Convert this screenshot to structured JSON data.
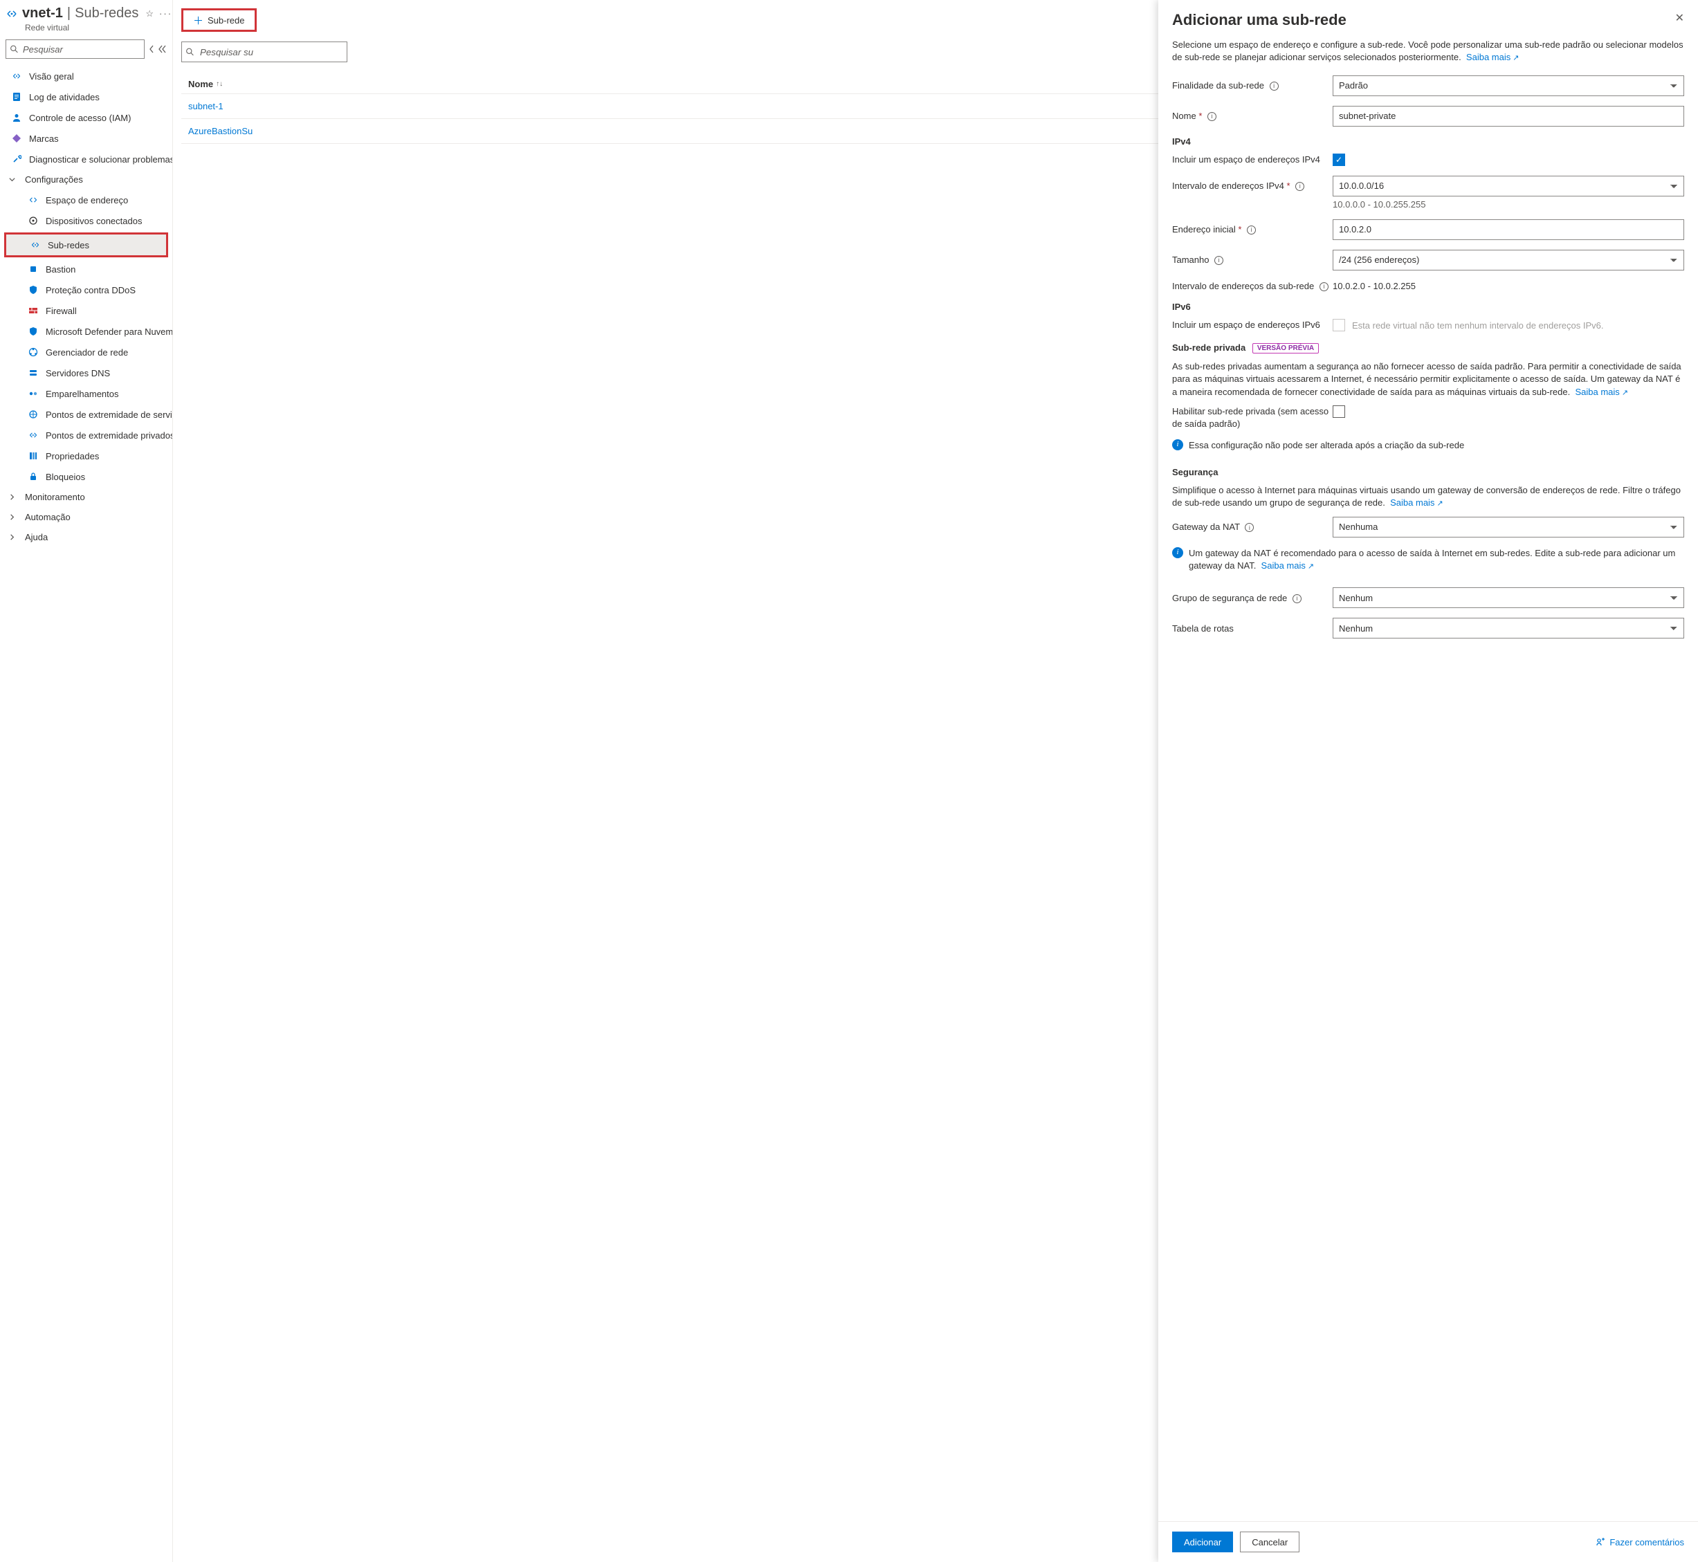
{
  "header": {
    "title": "vnet-1",
    "section": "Sub-redes",
    "subtype": "Rede virtual"
  },
  "sidebar": {
    "search_placeholder": "Pesquisar",
    "items": [
      {
        "label": "Visão geral"
      },
      {
        "label": "Log de atividades"
      },
      {
        "label": "Controle de acesso (IAM)"
      },
      {
        "label": "Marcas"
      },
      {
        "label": "Diagnosticar e solucionar problemas"
      }
    ],
    "config_group": "Configurações",
    "config_items": [
      {
        "label": "Espaço de endereço"
      },
      {
        "label": "Dispositivos conectados"
      },
      {
        "label": "Sub-redes"
      },
      {
        "label": "Bastion"
      },
      {
        "label": "Proteção contra DDoS"
      },
      {
        "label": "Firewall"
      },
      {
        "label": "Microsoft Defender para Nuvem"
      },
      {
        "label": "Gerenciador de rede"
      },
      {
        "label": "Servidores DNS"
      },
      {
        "label": "Emparelhamentos"
      },
      {
        "label": "Pontos de extremidade de serviço"
      },
      {
        "label": "Pontos de extremidade privados"
      },
      {
        "label": "Propriedades"
      },
      {
        "label": "Bloqueios"
      }
    ],
    "other_groups": [
      {
        "label": "Monitoramento"
      },
      {
        "label": "Automação"
      },
      {
        "label": "Ajuda"
      }
    ]
  },
  "content": {
    "toolbar_add": "Sub-rede",
    "search_placeholder": "Pesquisar su",
    "col_name": "Nome",
    "rows": [
      "subnet-1",
      "AzureBastionSu"
    ]
  },
  "panel": {
    "title": "Adicionar uma sub-rede",
    "desc": "Selecione um espaço de endereço e configure a sub-rede. Você pode personalizar uma sub-rede padrão ou selecionar modelos de sub-rede se planejar adicionar serviços selecionados posteriormente.",
    "learn_more": "Saiba mais",
    "purpose_label": "Finalidade da sub-rede",
    "purpose_value": "Padrão",
    "name_label": "Nome",
    "name_value": "subnet-private",
    "ipv4_section": "IPv4",
    "include_ipv4_label": "Incluir um espaço de endereços IPv4",
    "ipv4_range_label": "Intervalo de endereços IPv4",
    "ipv4_range_value": "10.0.0.0/16",
    "ipv4_range_span": "10.0.0.0 - 10.0.255.255",
    "start_addr_label": "Endereço inicial",
    "start_addr_value": "10.0.2.0",
    "size_label": "Tamanho",
    "size_value": "/24 (256 endereços)",
    "subnet_range_label": "Intervalo de endereços da sub-rede",
    "subnet_range_value": "10.0.2.0 - 10.0.2.255",
    "ipv6_section": "IPv6",
    "include_ipv6_label": "Incluir um espaço de endereços IPv6",
    "ipv6_disabled_msg": "Esta rede virtual não tem nenhum intervalo de endereços IPv6.",
    "private_section": "Sub-rede privada",
    "preview_badge": "VERSÃO PRÉVIA",
    "private_desc": "As sub-redes privadas aumentam a segurança ao não fornecer acesso de saída padrão. Para permitir a conectividade de saída para as máquinas virtuais acessarem a Internet, é necessário permitir explicitamente o acesso de saída. Um gateway da NAT é a maneira recomendada de fornecer conectividade de saída para as máquinas virtuais da sub-rede.",
    "enable_private_label": "Habilitar sub-rede privada (sem acesso de saída padrão)",
    "private_callout": "Essa configuração não pode ser alterada após a criação da sub-rede",
    "security_section": "Segurança",
    "security_desc": "Simplifique o acesso à Internet para máquinas virtuais usando um gateway de conversão de endereços de rede. Filtre o tráfego de sub-rede usando um grupo de segurança de rede.",
    "nat_label": "Gateway da NAT",
    "nat_value": "Nenhuma",
    "nat_callout": "Um gateway da NAT é recomendado para o acesso de saída à Internet em sub-redes. Edite a sub-rede para adicionar um gateway da NAT.",
    "nsg_label": "Grupo de segurança de rede",
    "nsg_value": "Nenhum",
    "route_label": "Tabela de rotas",
    "route_value": "Nenhum",
    "btn_add": "Adicionar",
    "btn_cancel": "Cancelar",
    "feedback": "Fazer comentários"
  }
}
